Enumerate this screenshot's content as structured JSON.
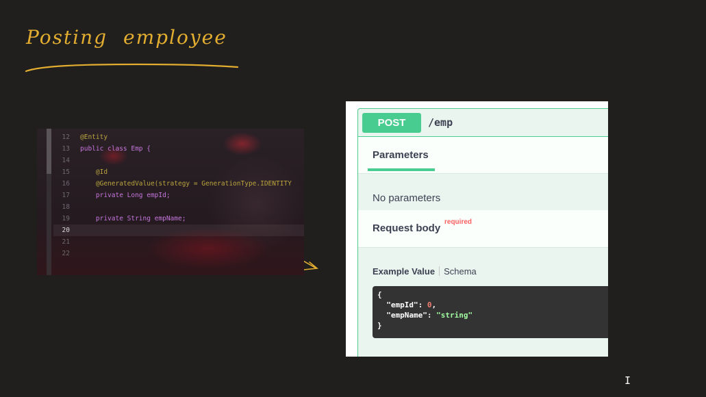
{
  "handwriting": {
    "word1": "Posting",
    "word2": "employee"
  },
  "editor": {
    "lines": [
      {
        "no": "12",
        "text": "@Entity"
      },
      {
        "no": "13",
        "text": "public class Emp {"
      },
      {
        "no": "14",
        "text": ""
      },
      {
        "no": "15",
        "text": "    @Id"
      },
      {
        "no": "16",
        "text": "    @GeneratedValue(strategy = GenerationType.IDENTITY"
      },
      {
        "no": "17",
        "text": "    private Long empId;"
      },
      {
        "no": "18",
        "text": ""
      },
      {
        "no": "19",
        "text": "    private String empName;"
      },
      {
        "no": "20",
        "text": ""
      },
      {
        "no": "21",
        "text": ""
      },
      {
        "no": "22",
        "text": ""
      }
    ],
    "current_line": "20"
  },
  "swagger": {
    "method": "POST",
    "path": "/emp",
    "parameters_title": "Parameters",
    "no_parameters": "No parameters",
    "request_body_title": "Request body",
    "required_badge": "required",
    "example_value_tab": "Example Value",
    "schema_tab": "Schema",
    "example": {
      "open": "{",
      "key1": "\"empId\"",
      "val1": "0",
      "key2": "\"empName\"",
      "val2": "\"string\"",
      "close": "}"
    }
  },
  "colors": {
    "ink": "#e3ae30",
    "post_green": "#49cc90",
    "background": "#201f1e"
  }
}
